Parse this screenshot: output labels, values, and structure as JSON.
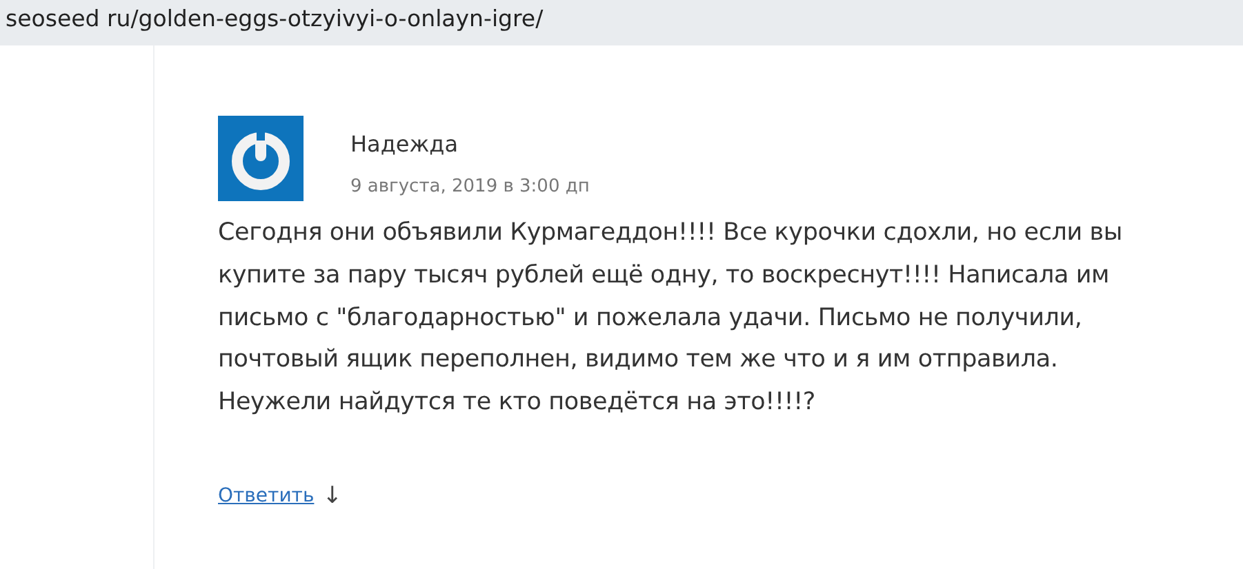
{
  "address_bar": {
    "url": "seoseed ru/golden-eggs-otzyivyi-o-onlayn-igre/"
  },
  "comment": {
    "author": "Надежда",
    "date": "9 августа, 2019 в 3:00 дп",
    "text": "Сегодня они объявили Курмагеддон!!!! Все курочки сдохли, но если вы купите за пару тысяч рублей ещё одну, то воскреснут!!!! Написала им письмо с \"благодарностью\" и пожелала удачи. Письмо не получили, почтовый ящик переполнен, видимо тем же что и я им отправила. Неужели найдутся те кто поведётся на это!!!!?",
    "reply_link": "Ответить",
    "reply_arrow": "↓"
  }
}
